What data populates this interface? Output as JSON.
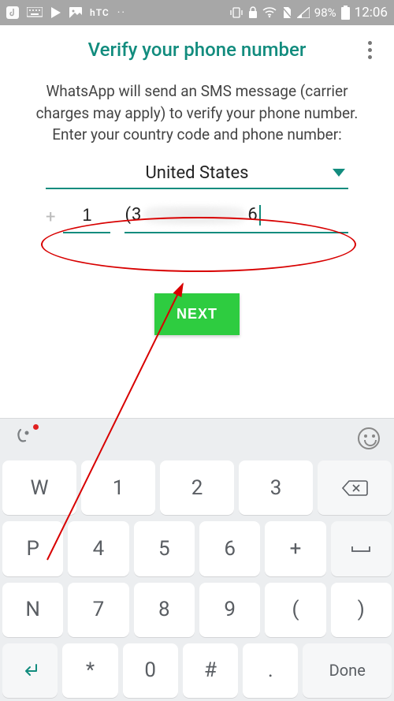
{
  "status_bar": {
    "battery_pct": "98%",
    "time": "12:06",
    "brand": "hTC"
  },
  "header": {
    "title": "Verify your phone number"
  },
  "instructions": "WhatsApp will send an SMS message (carrier charges may apply) to verify your phone number. Enter your country code and phone number:",
  "country": {
    "selected": "United States"
  },
  "phone": {
    "plus": "+",
    "country_code": "1",
    "number_prefix": "(3",
    "number_suffix": "6"
  },
  "next_button": "NEXT",
  "keyboard": {
    "rows": [
      [
        "W",
        "1",
        "2",
        "3",
        "⌫"
      ],
      [
        "P",
        "4",
        "5",
        "6",
        "+",
        "⌴"
      ],
      [
        "N",
        "7",
        "8",
        "9",
        "(",
        ")"
      ],
      [
        "↩",
        "*",
        "0",
        "#",
        ".",
        "Done"
      ]
    ]
  },
  "colors": {
    "teal": "#128c7e",
    "green": "#2ecc40",
    "annotation_red": "#d80000"
  }
}
